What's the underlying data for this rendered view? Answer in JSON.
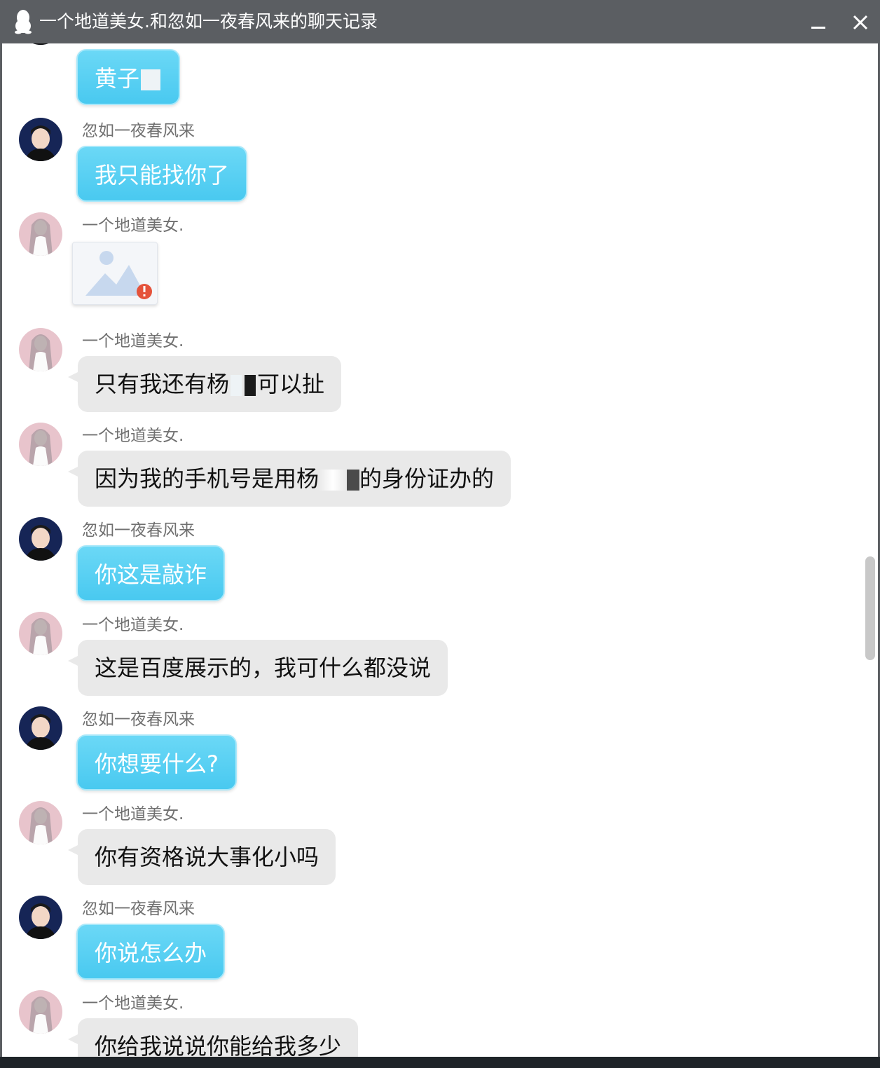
{
  "window": {
    "title": "一个地道美女.和忽如一夜春风来的聊天记录",
    "app_icon": "qq-penguin-icon",
    "minimize_icon": "minimize-icon",
    "close_icon": "close-icon"
  },
  "colors": {
    "titlebar": "#5b5e62",
    "self_bubble": "#5bd0f3",
    "other_bubble": "#e9e9e9",
    "sender_name": "#707070"
  },
  "messages": [
    {
      "sender": "",
      "text": "黄子",
      "mask": "light",
      "side": "self",
      "type": "text"
    },
    {
      "sender": "忽如一夜春风来",
      "text": "我只能找你了",
      "side": "self",
      "type": "text"
    },
    {
      "sender": "一个地道美女.",
      "text": "",
      "side": "other",
      "type": "image",
      "image_status": "failed-to-load"
    },
    {
      "sender": "一个地道美女.",
      "text_before": "只有我还有杨",
      "text_after": "可以扯",
      "side": "other",
      "type": "text"
    },
    {
      "sender": "一个地道美女.",
      "text_before": "因为我的手机号是用杨",
      "text_after": "的身份证办的",
      "side": "other",
      "type": "text"
    },
    {
      "sender": "忽如一夜春风来",
      "text": "你这是敲诈",
      "side": "self",
      "type": "text"
    },
    {
      "sender": "一个地道美女.",
      "text": "这是百度展示的，我可什么都没说",
      "side": "other",
      "type": "text"
    },
    {
      "sender": "忽如一夜春风来",
      "text": "你想要什么?",
      "side": "self",
      "type": "text"
    },
    {
      "sender": "一个地道美女.",
      "text": "你有资格说大事化小吗",
      "side": "other",
      "type": "text"
    },
    {
      "sender": "忽如一夜春风来",
      "text": "你说怎么办",
      "side": "self",
      "type": "text"
    },
    {
      "sender": "一个地道美女.",
      "text": "你给我说说你能给我多少",
      "side": "other",
      "type": "text"
    }
  ]
}
